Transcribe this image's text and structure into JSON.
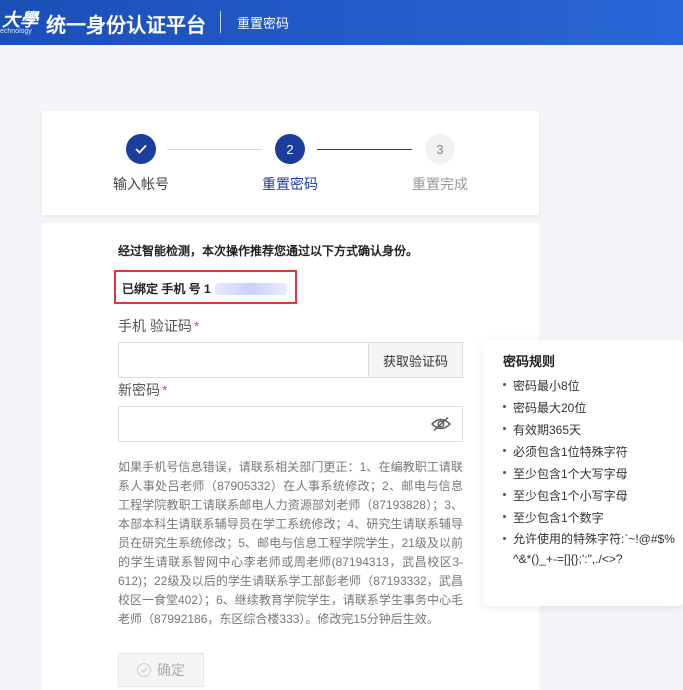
{
  "header": {
    "logo_cn": "大學",
    "logo_en": "echnology",
    "title": "统一身份认证平台",
    "page": "重置密码"
  },
  "steps": [
    {
      "number": "✓",
      "label": "输入帐号",
      "state": "done"
    },
    {
      "number": "2",
      "label": "重置密码",
      "state": "active"
    },
    {
      "number": "3",
      "label": "重置完成",
      "state": "pending"
    }
  ],
  "form": {
    "notice": "经过智能检测，本次操作推荐您通过以下方式确认身份。",
    "bound_phone": "已绑定 手机 号 1",
    "code_label": "手机 验证码",
    "code_value": "",
    "get_code_button": "获取验证码",
    "password_label": "新密码",
    "password_value": "",
    "required_mark": "*",
    "help": "如果手机号信息错误，请联系相关部门更正：1、在编教职工请联系人事处吕老师（87905332）在人事系统修改；2、邮电与信息工程学院教职工请联系邮电人力资源部刘老师（87193828）；3、本部本科生请联系辅导员在学工系统修改；4、研究生请联系辅导员在研究生系统修改；5、邮电与信息工程学院学生，21级及以前的学生请联系智网中心李老师或周老师(87194313，武昌校区3-612)；22级及以后的学生请联系学工部彭老师（87193332，武昌校区一食堂402）；6、继续教育学院学生，请联系学生事务中心毛老师（87992186，东区综合楼333）。修改完15分钟后生效。",
    "confirm_button": "确定"
  },
  "rules": {
    "title": "密码规则",
    "items": [
      "密码最小8位",
      "密码最大20位",
      "有效期365天",
      "必须包含1位特殊字符",
      "至少包含1个大写字母",
      "至少包含1个小写字母",
      "至少包含1个数字",
      "允许使用的特殊字符:`~!@#$%^&*()_+-=[]{};':\",./<>?"
    ]
  },
  "colors": {
    "primary": "#1a3d9e",
    "header_start": "#1b4fb8",
    "header_end": "#2a66d8",
    "highlight_border": "#d9363e",
    "required": "#e34d59"
  }
}
